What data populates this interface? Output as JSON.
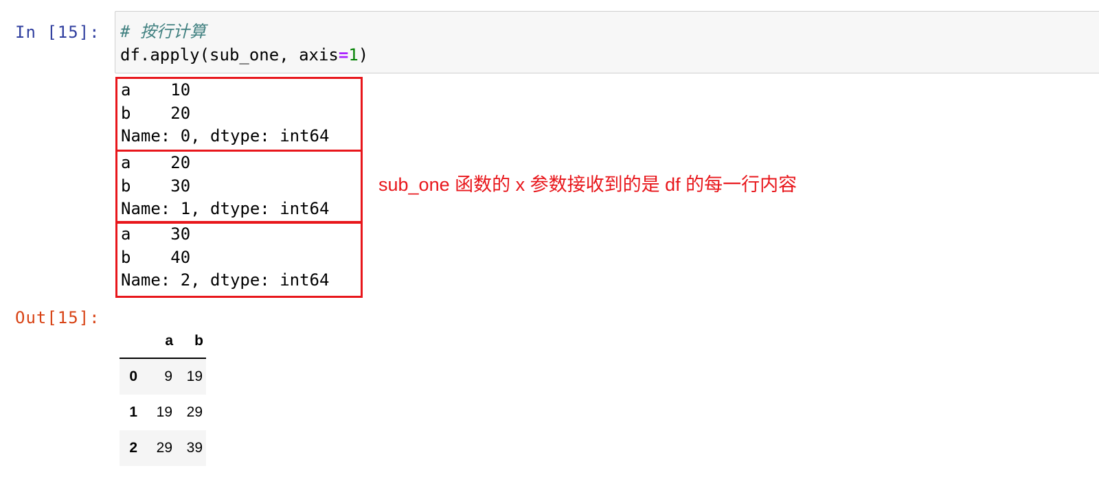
{
  "cell": {
    "in_prompt": "In [15]:",
    "out_prompt": "Out[15]:",
    "code": {
      "comment": "# 按行计算",
      "line2_call": "df.apply(sub_one, axis",
      "line2_op": "=",
      "line2_num": "1",
      "line2_close": ")"
    }
  },
  "stdout_blocks": [
    {
      "line1": "a    10",
      "line2": "b    20",
      "line3": "Name: 0, dtype: int64"
    },
    {
      "line1": "a    20",
      "line2": "b    30",
      "line3": "Name: 1, dtype: int64"
    },
    {
      "line1": "a    30",
      "line2": "b    40",
      "line3": "Name: 2, dtype: int64"
    }
  ],
  "annotation": {
    "text": "sub_one 函数的 x 参数接收到的是 df 的每一行内容",
    "color": "#e8161b"
  },
  "dataframe": {
    "columns": [
      "a",
      "b"
    ],
    "rows": [
      {
        "index": "0",
        "a": "9",
        "b": "19"
      },
      {
        "index": "1",
        "a": "19",
        "b": "29"
      },
      {
        "index": "2",
        "a": "29",
        "b": "39"
      }
    ]
  },
  "colors": {
    "in_prompt": "#303f9f",
    "out_prompt": "#d84315",
    "highlight_box": "#e8161b",
    "comment": "#408080",
    "operator": "#aa22ff",
    "number": "#008000"
  }
}
